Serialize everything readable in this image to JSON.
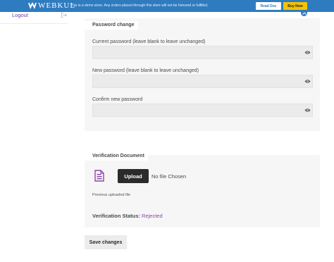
{
  "banner": {
    "logo_text": "WEBKUL",
    "message": "This is a demo store. Any orders placed through this store will not be honored or fulfilled.",
    "read_doc_label": "Read Doc",
    "buy_now_label": "Buy Now"
  },
  "sidebar": {
    "logout_label": "Logout"
  },
  "password_section": {
    "legend": "Password change",
    "fields": [
      {
        "label": "Current password (leave blank to leave unchanged)",
        "value": ""
      },
      {
        "label": "New password (leave blank to leave unchanged)",
        "value": ""
      },
      {
        "label": "Confirm new password",
        "value": ""
      }
    ]
  },
  "verification_section": {
    "legend": "Verification Document",
    "upload_label": "Upload",
    "no_file_text": "No file Chosen",
    "previous_file_text": "Previous uploaded file",
    "status_label": "Verification Status:",
    "status_value": "Rejected",
    "status_color": "#8e45a8"
  },
  "save_label": "Save changes",
  "colors": {
    "banner": "#2f7bbf",
    "buy_now": "#f5c300",
    "accent": "#6a3ea1"
  },
  "icons": [
    "webkul-logo-icon",
    "scroll-top-icon",
    "logout-icon",
    "eye-icon",
    "document-icon"
  ]
}
